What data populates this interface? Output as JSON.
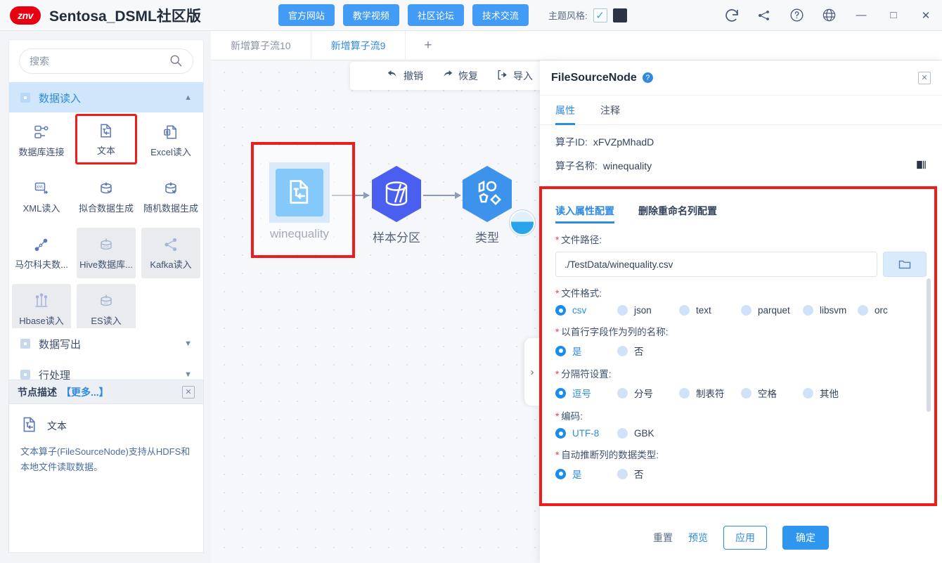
{
  "titlebar": {
    "logo_text": "znv",
    "app_title": "Sentosa_DSML社区版",
    "nav_buttons": [
      {
        "label": "官方网站",
        "name": "official-site-button"
      },
      {
        "label": "教学视频",
        "name": "tutorial-video-button"
      },
      {
        "label": "社区论坛",
        "name": "community-forum-button"
      },
      {
        "label": "技术交流",
        "name": "tech-exchange-button"
      }
    ],
    "theme_label": "主题风格:",
    "theme_checked": "✓",
    "theme_swatch_color": "#2b3445",
    "icons": [
      "refresh-icon",
      "share-icon",
      "help-icon",
      "globe-icon"
    ],
    "window_minimize": "—",
    "window_maximize": "□",
    "window_close": "✕"
  },
  "left_panel": {
    "search_placeholder": "搜索",
    "search_value": "",
    "sections": [
      {
        "label": "数据读入",
        "expanded": true
      },
      {
        "label": "数据写出",
        "expanded": false
      },
      {
        "label": "行处理",
        "expanded": false
      }
    ],
    "palette_items": [
      {
        "label": "数据库连接",
        "icon": "database-connect-icon",
        "state": "normal"
      },
      {
        "label": "文本",
        "icon": "text-file-icon",
        "state": "selected"
      },
      {
        "label": "Excel读入",
        "icon": "excel-file-icon",
        "state": "normal"
      },
      {
        "label": "XML读入",
        "icon": "xml-file-icon",
        "state": "normal"
      },
      {
        "label": "拟合数据生成",
        "icon": "fit-data-icon",
        "state": "normal"
      },
      {
        "label": "随机数据生成",
        "icon": "random-data-icon",
        "state": "normal"
      },
      {
        "label": "马尔科夫数...",
        "icon": "markov-data-icon",
        "state": "normal"
      },
      {
        "label": "Hive数据库...",
        "icon": "hive-icon",
        "state": "shaded"
      },
      {
        "label": "Kafka读入",
        "icon": "kafka-icon",
        "state": "shaded"
      },
      {
        "label": "Hbase读入",
        "icon": "hbase-icon",
        "state": "shaded"
      },
      {
        "label": "ES读入",
        "icon": "es-icon",
        "state": "shaded"
      }
    ],
    "description": {
      "header": "节点描述",
      "more": "【更多...】",
      "node_title": "文本",
      "body": "文本算子(FileSourceNode)支持从HDFS和本地文件读取数据。"
    }
  },
  "canvas": {
    "tabs": [
      {
        "label": "新增算子流10",
        "active": false
      },
      {
        "label": "新增算子流9",
        "active": true
      }
    ],
    "add_tab": "+",
    "toolbar": [
      {
        "label": "撤销",
        "icon": "undo-icon"
      },
      {
        "label": "恢复",
        "icon": "redo-icon"
      },
      {
        "label": "导入",
        "icon": "import-icon"
      }
    ],
    "nodes": [
      {
        "label": "winequality",
        "icon": "text-file-icon",
        "selected": true
      },
      {
        "label": "样本分区",
        "icon": "sample-partition-icon",
        "selected": false
      },
      {
        "label": "类型",
        "icon": "type-icon",
        "selected": false
      }
    ]
  },
  "right_panel": {
    "title": "FileSourceNode",
    "help_icon": "?",
    "close_icon": "✕",
    "tabs": [
      {
        "label": "属性",
        "active": true
      },
      {
        "label": "注释",
        "active": false
      }
    ],
    "operator_id_label": "算子ID:",
    "operator_id_value": "xFVZpMhadD",
    "operator_name_label": "算子名称:",
    "operator_name_value": "winequality",
    "config_tabs": [
      {
        "label": "读入属性配置",
        "active": true
      },
      {
        "label": "删除重命名列配置",
        "active": false
      }
    ],
    "fields": [
      {
        "label": "文件路径:",
        "required": true,
        "type": "path",
        "value": "./TestData/winequality.csv",
        "browse_icon": "folder-icon"
      },
      {
        "label": "文件格式:",
        "required": true,
        "type": "radio",
        "options": [
          "csv",
          "json",
          "text",
          "parquet",
          "libsvm",
          "orc"
        ],
        "selected": "csv"
      },
      {
        "label": "以首行字段作为列的名称:",
        "required": true,
        "type": "radio",
        "options": [
          "是",
          "否"
        ],
        "selected": "是"
      },
      {
        "label": "分隔符设置:",
        "required": true,
        "type": "radio",
        "options": [
          "逗号",
          "分号",
          "制表符",
          "空格",
          "其他"
        ],
        "selected": "逗号"
      },
      {
        "label": "编码:",
        "required": true,
        "type": "radio",
        "options": [
          "UTF-8",
          "GBK"
        ],
        "selected": "UTF-8"
      },
      {
        "label": "自动推断列的数据类型:",
        "required": true,
        "type": "radio",
        "options": [
          "是",
          "否"
        ],
        "selected": "是"
      }
    ],
    "footer": {
      "reset": "重置",
      "preview": "预览",
      "apply": "应用",
      "confirm": "确定"
    },
    "collapse_icon": "›"
  },
  "colors": {
    "accent": "#2f8ae0",
    "primary_button": "#429bf5",
    "highlight_red": "#f01c1c",
    "node_blue": "#1f9df5",
    "hex_purple": "#4a5ef0"
  }
}
